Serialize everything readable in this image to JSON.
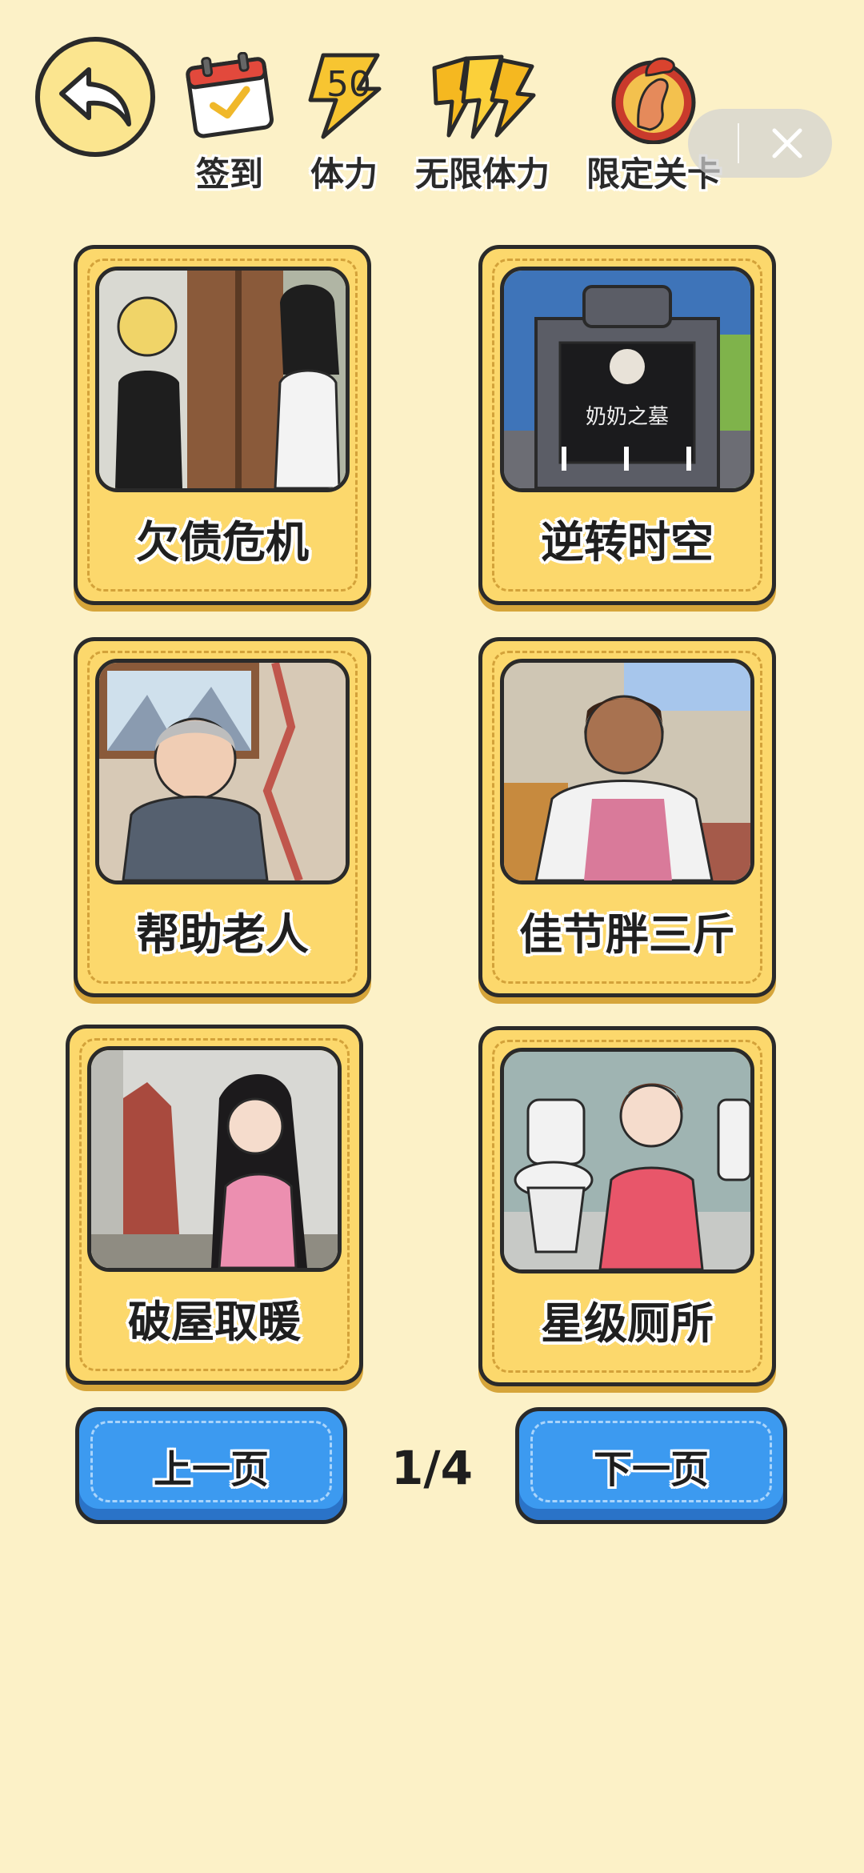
{
  "top_bar": {
    "checkin_label": "签到",
    "stamina_label": "体力",
    "stamina_value": "50",
    "unlimited_label": "无限体力",
    "limited_label": "限定关卡"
  },
  "levels": [
    {
      "title": "欠债危机"
    },
    {
      "title": "逆转时空",
      "tomb_text": "奶奶之墓"
    },
    {
      "title": "帮助老人"
    },
    {
      "title": "佳节胖三斤"
    },
    {
      "title": "破屋取暖"
    },
    {
      "title": "星级厕所"
    }
  ],
  "pager": {
    "prev_label": "上一页",
    "next_label": "下一页",
    "page_indicator": "1/4"
  },
  "colors": {
    "background": "#fcf1c7",
    "card": "#fcd86c",
    "button_blue": "#3c9af0",
    "outline": "#2a2a2a"
  }
}
